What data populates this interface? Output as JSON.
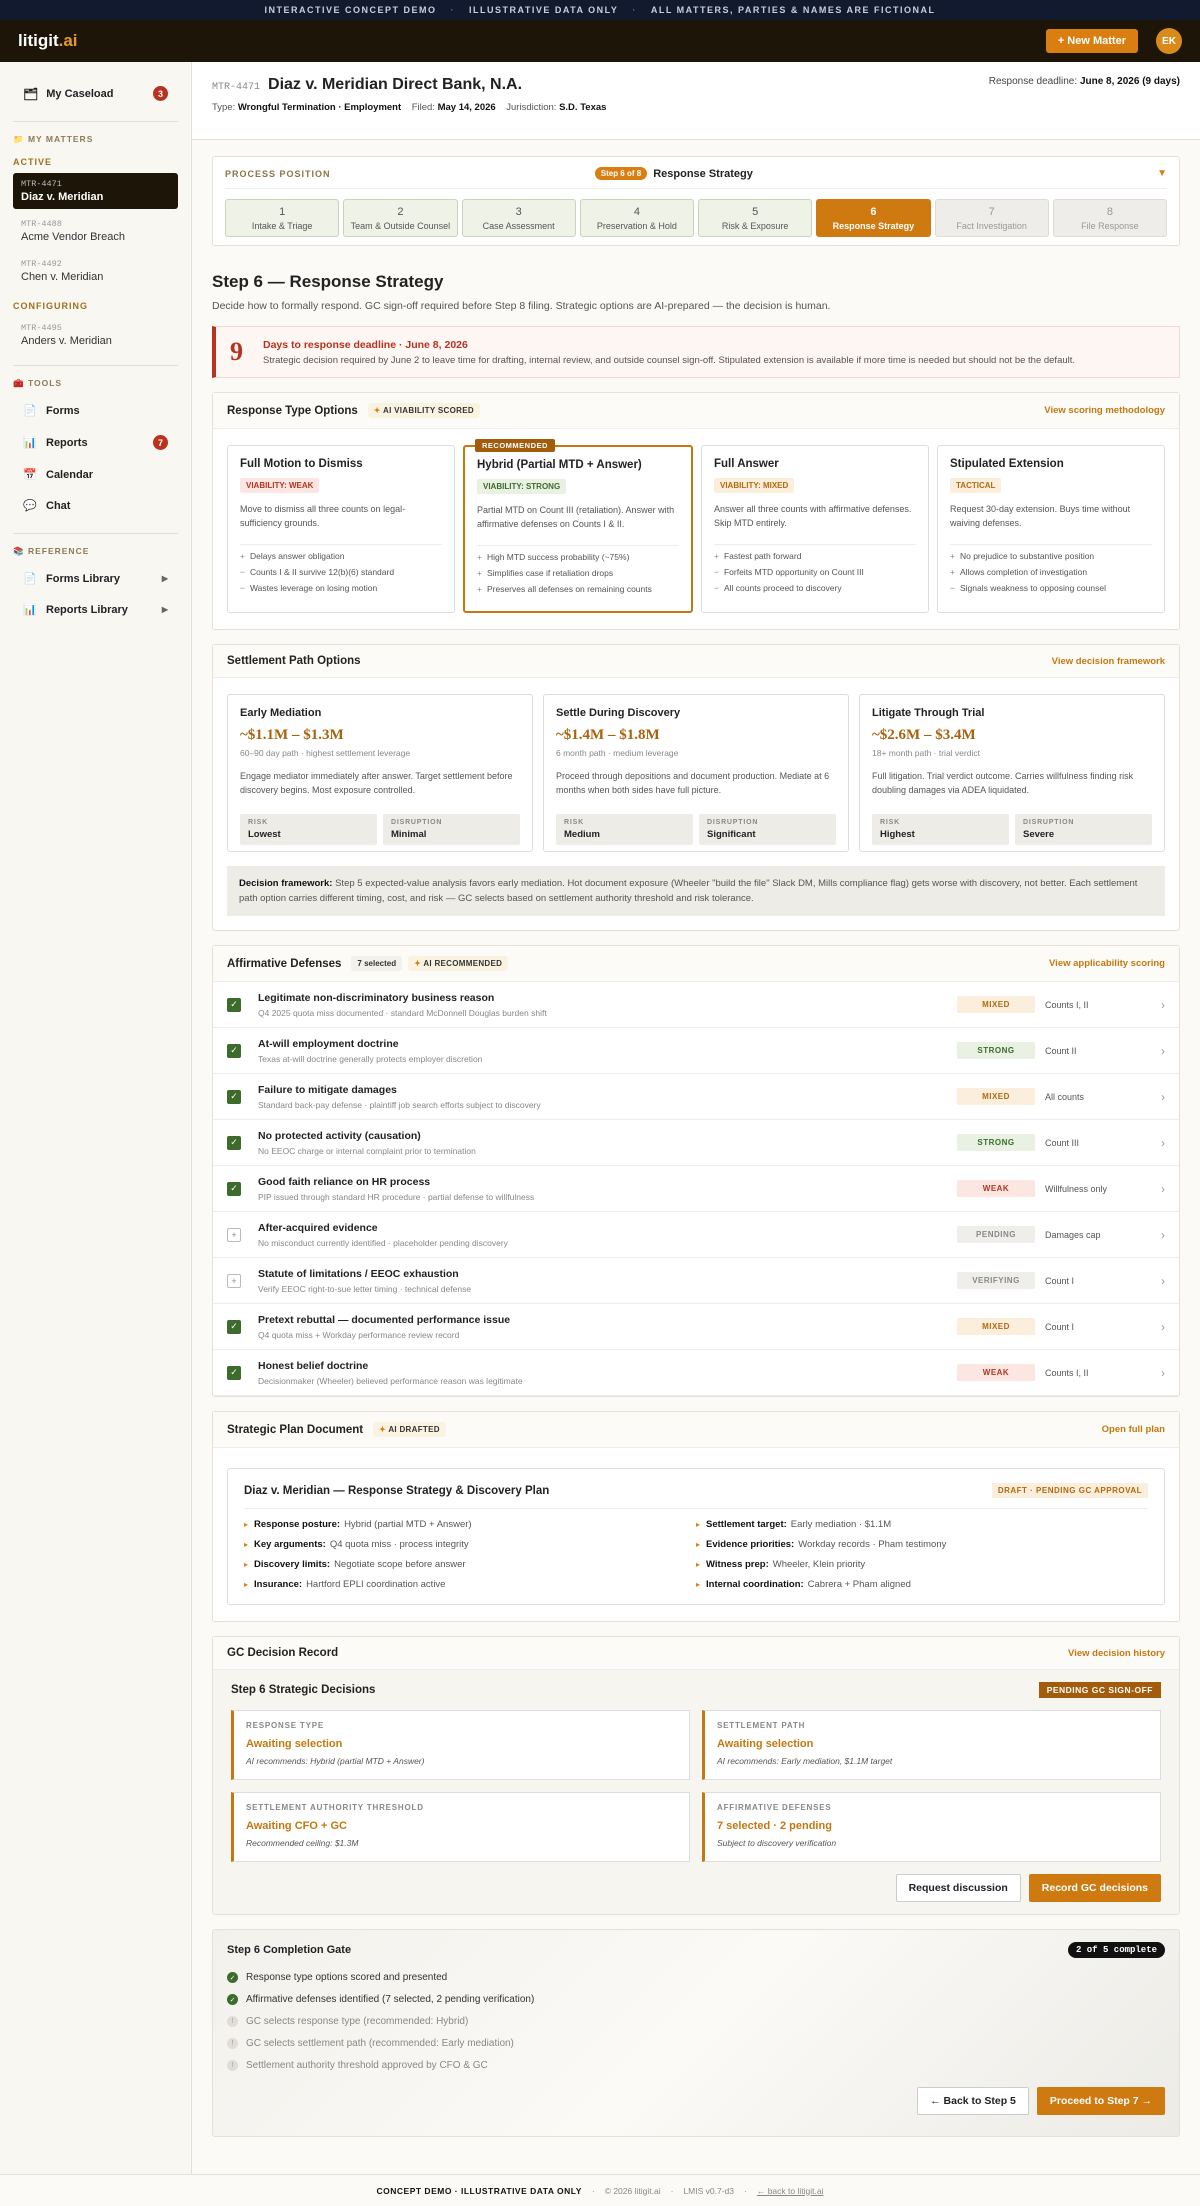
{
  "banner": [
    "INTERACTIVE CONCEPT DEMO",
    "ILLUSTRATIVE DATA ONLY",
    "ALL MATTERS, PARTIES & NAMES ARE FICTIONAL"
  ],
  "header": {
    "logo_main": "litigit",
    "logo_ai": ".ai",
    "new_matter": "+ New Matter",
    "avatar": "EK"
  },
  "sidebar": {
    "caseload": "My Caseload",
    "caseload_count": "3",
    "my_matters": "MY MATTERS",
    "active": "ACTIVE",
    "configuring": "CONFIGURING",
    "matters": [
      {
        "id": "MTR-4471",
        "name": "Diaz v. Meridian"
      },
      {
        "id": "MTR-4488",
        "name": "Acme Vendor Breach"
      },
      {
        "id": "MTR-4492",
        "name": "Chen v. Meridian"
      },
      {
        "id": "MTR-4495",
        "name": "Anders v. Meridian"
      }
    ],
    "tools": "TOOLS",
    "forms": "Forms",
    "reports": "Reports",
    "reports_count": "7",
    "calendar": "Calendar",
    "chat": "Chat",
    "reference": "REFERENCE",
    "forms_library": "Forms Library",
    "reports_library": "Reports Library"
  },
  "matter": {
    "id": "MTR-4471",
    "title": "Diaz v. Meridian Direct Bank, N.A.",
    "deadline_label": "Response deadline:",
    "deadline": "June 8, 2026 (9 days)",
    "type_label": "Type:",
    "type": "Wrongful Termination · Employment",
    "filed_label": "Filed:",
    "filed": "May 14, 2026",
    "jur_label": "Jurisdiction:",
    "jur": "S.D. Texas"
  },
  "process": {
    "label": "PROCESS POSITION",
    "pill": "Step 6 of 8",
    "name": "Response Strategy",
    "steps": [
      {
        "n": "1",
        "l": "Intake & Triage"
      },
      {
        "n": "2",
        "l": "Team & Outside Counsel"
      },
      {
        "n": "3",
        "l": "Case Assessment"
      },
      {
        "n": "4",
        "l": "Preservation & Hold"
      },
      {
        "n": "5",
        "l": "Risk & Exposure"
      },
      {
        "n": "6",
        "l": "Response Strategy"
      },
      {
        "n": "7",
        "l": "Fact Investigation"
      },
      {
        "n": "8",
        "l": "File Response"
      }
    ]
  },
  "page": {
    "title": "Step 6 — Response Strategy",
    "subtitle": "Decide how to formally respond. GC sign-off required before Step 8 filing. Strategic options are AI-prepared — the decision is human."
  },
  "deadline_box": {
    "num": "9",
    "title": "Days to response deadline · June 8, 2026",
    "text": "Strategic decision required by June 2 to leave time for drafting, internal review, and outside counsel sign-off. Stipulated extension is available if more time is needed but should not be the default."
  },
  "response": {
    "title": "Response Type Options",
    "ai": "AI VIABILITY SCORED",
    "link": "View scoring methodology",
    "rec_tag": "RECOMMENDED",
    "options": [
      {
        "title": "Full Motion to Dismiss",
        "tag": "VIABILITY: WEAK",
        "desc": "Move to dismiss all three counts on legal-sufficiency grounds.",
        "items": [
          {
            "m": "+",
            "t": "Delays answer obligation"
          },
          {
            "m": "−",
            "t": "Counts I & II survive 12(b)(6) standard"
          },
          {
            "m": "−",
            "t": "Wastes leverage on losing motion"
          }
        ]
      },
      {
        "title": "Hybrid (Partial MTD + Answer)",
        "tag": "VIABILITY: STRONG",
        "desc": "Partial MTD on Count III (retaliation). Answer with affirmative defenses on Counts I & II.",
        "items": [
          {
            "m": "+",
            "t": "High MTD success probability (~75%)"
          },
          {
            "m": "+",
            "t": "Simplifies case if retaliation drops"
          },
          {
            "m": "+",
            "t": "Preserves all defenses on remaining counts"
          }
        ]
      },
      {
        "title": "Full Answer",
        "tag": "VIABILITY: MIXED",
        "desc": "Answer all three counts with affirmative defenses. Skip MTD entirely.",
        "items": [
          {
            "m": "+",
            "t": "Fastest path forward"
          },
          {
            "m": "−",
            "t": "Forfeits MTD opportunity on Count III"
          },
          {
            "m": "−",
            "t": "All counts proceed to discovery"
          }
        ]
      },
      {
        "title": "Stipulated Extension",
        "tag": "TACTICAL",
        "desc": "Request 30-day extension. Buys time without waiving defenses.",
        "items": [
          {
            "m": "+",
            "t": "No prejudice to substantive position"
          },
          {
            "m": "+",
            "t": "Allows completion of investigation"
          },
          {
            "m": "−",
            "t": "Signals weakness to opposing counsel"
          }
        ]
      }
    ]
  },
  "settlement": {
    "title": "Settlement Path Options",
    "link": "View decision framework",
    "risk_label": "RISK",
    "dis_label": "DISRUPTION",
    "options": [
      {
        "title": "Early Mediation",
        "amt": "~$1.1M – $1.3M",
        "sub": "60–90 day path · highest settlement leverage",
        "desc": "Engage mediator immediately after answer. Target settlement before discovery begins. Most exposure controlled.",
        "risk": "Lowest",
        "dis": "Minimal"
      },
      {
        "title": "Settle During Discovery",
        "amt": "~$1.4M – $1.8M",
        "sub": "6 month path · medium leverage",
        "desc": "Proceed through depositions and document production. Mediate at 6 months when both sides have full picture.",
        "risk": "Medium",
        "dis": "Significant"
      },
      {
        "title": "Litigate Through Trial",
        "amt": "~$2.6M – $3.4M",
        "sub": "18+ month path · trial verdict",
        "desc": "Full litigation. Trial verdict outcome. Carries willfulness finding risk doubling damages via ADEA liquidated.",
        "risk": "Highest",
        "dis": "Severe"
      }
    ],
    "fw_label": "Decision framework:",
    "fw_text": "Step 5 expected-value analysis favors early mediation. Hot document exposure (Wheeler \"build the file\" Slack DM, Mills compliance flag) gets worse with discovery, not better. Each settlement path option carries different timing, cost, and risk — GC selects based on settlement authority threshold and risk tolerance."
  },
  "defenses": {
    "title": "Affirmative Defenses",
    "count": "7 selected",
    "ai": "AI RECOMMENDED",
    "link": "View applicability scoring",
    "items": [
      {
        "on": true,
        "title": "Legitimate non-discriminatory business reason",
        "sub": "Q4 2025 quota miss documented · standard McDonnell Douglas burden shift",
        "tag": "MIXED",
        "cls": "d-mixed",
        "counts": "Counts I, II"
      },
      {
        "on": true,
        "title": "At-will employment doctrine",
        "sub": "Texas at-will doctrine generally protects employer discretion",
        "tag": "STRONG",
        "cls": "d-strong",
        "counts": "Count II"
      },
      {
        "on": true,
        "title": "Failure to mitigate damages",
        "sub": "Standard back-pay defense · plaintiff job search efforts subject to discovery",
        "tag": "MIXED",
        "cls": "d-mixed",
        "counts": "All counts"
      },
      {
        "on": true,
        "title": "No protected activity (causation)",
        "sub": "No EEOC charge or internal complaint prior to termination",
        "tag": "STRONG",
        "cls": "d-strong",
        "counts": "Count III"
      },
      {
        "on": true,
        "title": "Good faith reliance on HR process",
        "sub": "PIP issued through standard HR procedure · partial defense to willfulness",
        "tag": "WEAK",
        "cls": "d-weak",
        "counts": "Willfulness only"
      },
      {
        "on": false,
        "title": "After-acquired evidence",
        "sub": "No misconduct currently identified · placeholder pending discovery",
        "tag": "PENDING",
        "cls": "d-pending",
        "counts": "Damages cap"
      },
      {
        "on": false,
        "title": "Statute of limitations / EEOC exhaustion",
        "sub": "Verify EEOC right-to-sue letter timing · technical defense",
        "tag": "VERIFYING",
        "cls": "d-pending",
        "counts": "Count I"
      },
      {
        "on": true,
        "title": "Pretext rebuttal — documented performance issue",
        "sub": "Q4 quota miss + Workday performance review record",
        "tag": "MIXED",
        "cls": "d-mixed",
        "counts": "Count I"
      },
      {
        "on": true,
        "title": "Honest belief doctrine",
        "sub": "Decisionmaker (Wheeler) believed performance reason was legitimate",
        "tag": "WEAK",
        "cls": "d-weak",
        "counts": "Counts I, II"
      }
    ]
  },
  "plan": {
    "title": "Strategic Plan Document",
    "ai": "AI DRAFTED",
    "link": "Open full plan",
    "doc_title": "Diaz v. Meridian — Response Strategy & Discovery Plan",
    "draft": "DRAFT · PENDING GC APPROVAL",
    "items": [
      {
        "k": "Response posture:",
        "v": "Hybrid (partial MTD + Answer)"
      },
      {
        "k": "Settlement target:",
        "v": "Early mediation · $1.1M"
      },
      {
        "k": "Key arguments:",
        "v": "Q4 quota miss · process integrity"
      },
      {
        "k": "Evidence priorities:",
        "v": "Workday records · Pham testimony"
      },
      {
        "k": "Discovery limits:",
        "v": "Negotiate scope before answer"
      },
      {
        "k": "Witness prep:",
        "v": "Wheeler, Klein priority"
      },
      {
        "k": "Insurance:",
        "v": "Hartford EPLI coordination active"
      },
      {
        "k": "Internal coordination:",
        "v": "Cabrera + Pham aligned"
      }
    ]
  },
  "gc": {
    "title": "GC Decision Record",
    "link": "View decision history",
    "inner_title": "Step 6 Strategic Decisions",
    "pending": "PENDING GC SIGN-OFF",
    "decisions": [
      {
        "l": "RESPONSE TYPE",
        "v": "Awaiting selection",
        "r": "AI recommends: Hybrid (partial MTD + Answer)"
      },
      {
        "l": "SETTLEMENT PATH",
        "v": "Awaiting selection",
        "r": "AI recommends: Early mediation, $1.1M target"
      },
      {
        "l": "SETTLEMENT AUTHORITY THRESHOLD",
        "v": "Awaiting CFO + GC",
        "r": "Recommended ceiling: $1.3M"
      },
      {
        "l": "AFFIRMATIVE DEFENSES",
        "v": "7 selected · 2 pending",
        "r": "Subject to discovery verification"
      }
    ],
    "request": "Request discussion",
    "record": "Record GC decisions"
  },
  "gate": {
    "title": "Step 6 Completion Gate",
    "count": "2 of 5 complete",
    "items": [
      {
        "done": true,
        "t": "Response type options scored and presented"
      },
      {
        "done": true,
        "t": "Affirmative defenses identified (7 selected, 2 pending verification)"
      },
      {
        "done": false,
        "t": "GC selects response type (recommended: Hybrid)"
      },
      {
        "done": false,
        "t": "GC selects settlement path (recommended: Early mediation)"
      },
      {
        "done": false,
        "t": "Settlement authority threshold approved by CFO & GC"
      }
    ],
    "back": "← Back to Step 5",
    "next": "Proceed to Step 7 →"
  },
  "footer": {
    "demo": "CONCEPT DEMO · ILLUSTRATIVE DATA ONLY",
    "copy": "© 2026 litigit.ai",
    "ver": "LMIS v0.7-d3",
    "back": "← back to litigit.ai"
  }
}
